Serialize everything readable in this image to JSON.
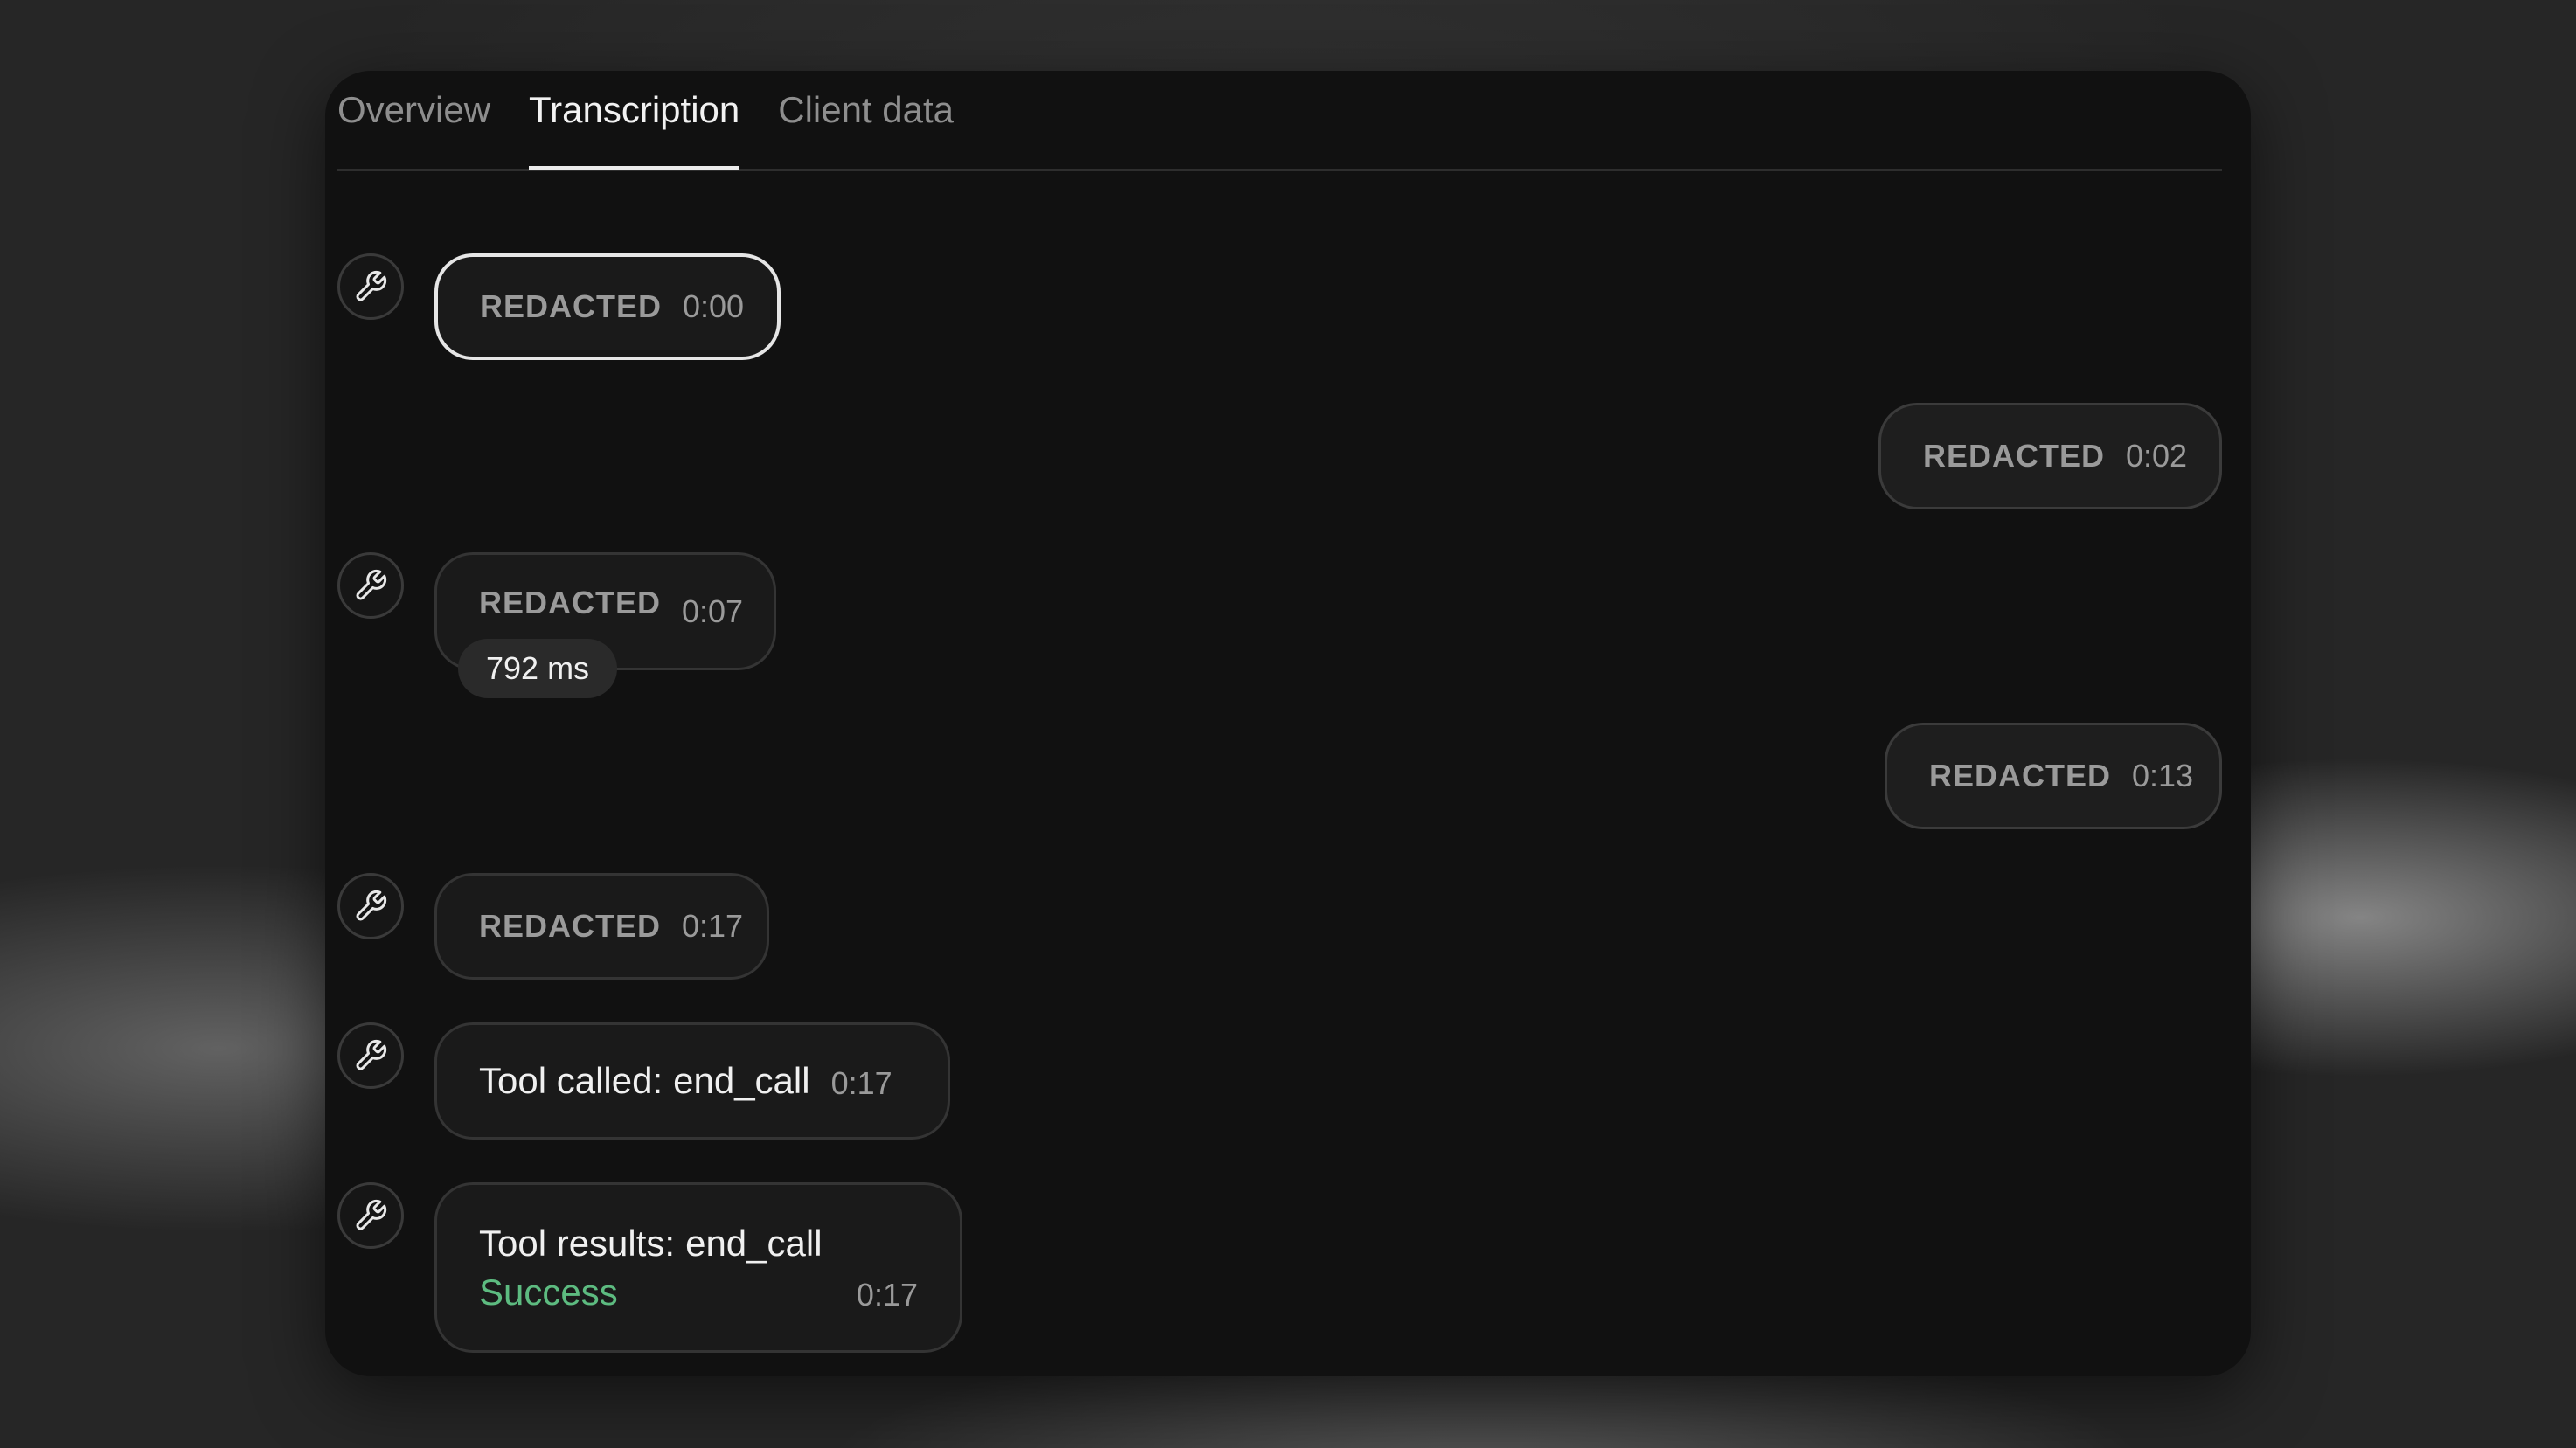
{
  "tabs": [
    {
      "label": "Overview",
      "active": false
    },
    {
      "label": "Transcription",
      "active": true
    },
    {
      "label": "Client data",
      "active": false
    }
  ],
  "messages": [
    {
      "side": "agent",
      "text": "REDACTED",
      "time": "0:00",
      "icon": "wrench-icon",
      "highlighted": true
    },
    {
      "side": "user",
      "text": "REDACTED",
      "time": "0:02"
    },
    {
      "side": "agent",
      "text": "REDACTED",
      "time": "0:07",
      "icon": "wrench-icon",
      "latency": "792 ms"
    },
    {
      "side": "user",
      "text": "REDACTED",
      "time": "0:13"
    },
    {
      "side": "agent",
      "text": "REDACTED",
      "time": "0:17",
      "icon": "wrench-icon"
    },
    {
      "side": "agent",
      "type": "tool_call",
      "label": "Tool called:",
      "tool": "end_call",
      "time": "0:17",
      "icon": "wrench-icon"
    },
    {
      "side": "agent",
      "type": "tool_result",
      "label": "Tool results:",
      "tool": "end_call",
      "status": "Success",
      "time": "0:17",
      "icon": "wrench-icon"
    }
  ],
  "colors": {
    "success": "#5dbb80",
    "panel": "#111111",
    "bubble_border": "#343434"
  }
}
